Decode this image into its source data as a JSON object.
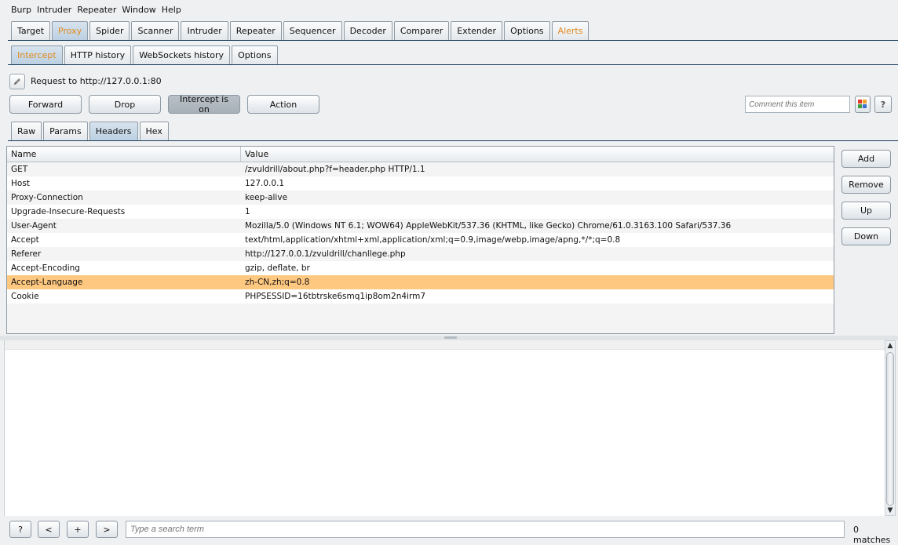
{
  "menu": [
    "Burp",
    "Intruder",
    "Repeater",
    "Window",
    "Help"
  ],
  "main_tabs": [
    "Target",
    "Proxy",
    "Spider",
    "Scanner",
    "Intruder",
    "Repeater",
    "Sequencer",
    "Decoder",
    "Comparer",
    "Extender",
    "Options",
    "Alerts"
  ],
  "main_tab_active": "Proxy",
  "sub_tabs": [
    "Intercept",
    "HTTP history",
    "WebSockets history",
    "Options"
  ],
  "sub_tab_active": "Intercept",
  "request_label": "Request to http://127.0.0.1:80",
  "buttons": {
    "forward": "Forward",
    "drop": "Drop",
    "intercept": "Intercept is on",
    "action": "Action"
  },
  "comment_placeholder": "Comment this item",
  "help_glyph": "?",
  "view_tabs": [
    "Raw",
    "Params",
    "Headers",
    "Hex"
  ],
  "view_tab_active": "Headers",
  "table": {
    "columns": [
      "Name",
      "Value"
    ],
    "rows": [
      {
        "name": "GET",
        "value": "/zvuldrill/about.php?f=header.php HTTP/1.1"
      },
      {
        "name": "Host",
        "value": "127.0.0.1"
      },
      {
        "name": "Proxy-Connection",
        "value": "keep-alive"
      },
      {
        "name": "Upgrade-Insecure-Requests",
        "value": "1"
      },
      {
        "name": "User-Agent",
        "value": "Mozilla/5.0 (Windows NT 6.1; WOW64) AppleWebKit/537.36 (KHTML, like Gecko) Chrome/61.0.3163.100 Safari/537.36"
      },
      {
        "name": "Accept",
        "value": "text/html,application/xhtml+xml,application/xml;q=0.9,image/webp,image/apng,*/*;q=0.8"
      },
      {
        "name": "Referer",
        "value": "http://127.0.0.1/zvuldrill/chanllege.php"
      },
      {
        "name": "Accept-Encoding",
        "value": "gzip, deflate, br"
      },
      {
        "name": "Accept-Language",
        "value": "zh-CN,zh;q=0.8"
      },
      {
        "name": "Cookie",
        "value": "PHPSESSID=16tbtrske6smq1ip8om2n4irm7"
      }
    ],
    "selected_row": "Accept-Language"
  },
  "side_buttons": [
    "Add",
    "Remove",
    "Up",
    "Down"
  ],
  "bottom_buttons": [
    "?",
    "<",
    "+",
    ">"
  ],
  "search_placeholder": "Type a search term",
  "matches": "0 matches",
  "colors": {
    "accent_orange": "#e08a1e",
    "selected_row": "#ffc880",
    "tab_active": "#c6d7e7"
  }
}
